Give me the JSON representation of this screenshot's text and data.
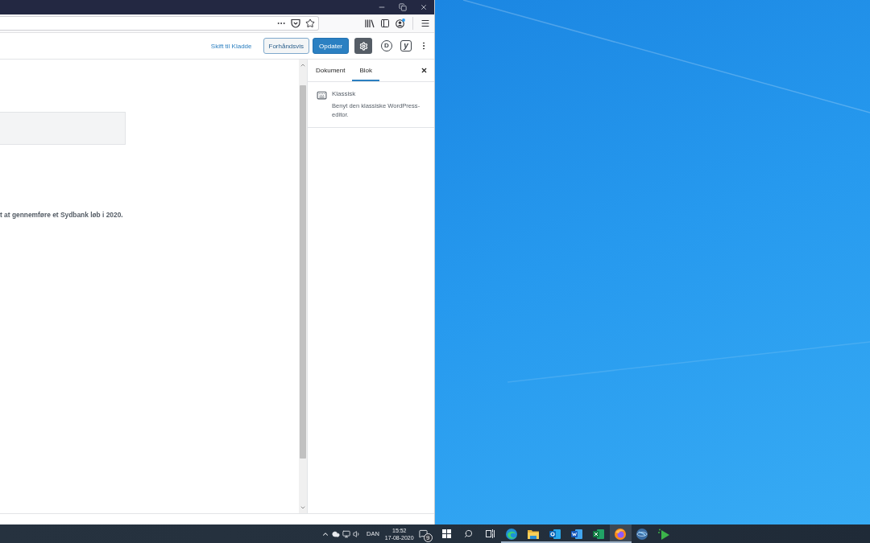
{
  "editor_header": {
    "switch_to_draft_link": "Skift til Kladde",
    "preview_button": "Forhåndsvis",
    "update_button": "Opdater",
    "settings_button": {
      "pressed": true
    },
    "plugin_buttons": [
      {
        "kind": "circle",
        "label": "D"
      },
      {
        "kind": "square",
        "label": "y"
      }
    ]
  },
  "editor_canvas": {
    "paragraph": "t at gennemføre et Sydbank løb i 2020."
  },
  "sidebar": {
    "tabs": [
      {
        "label": "Dokument",
        "selected": false
      },
      {
        "label": "Blok",
        "selected": true
      }
    ],
    "block": {
      "name": "Klassisk",
      "description": "Benyt den klassiske WordPress-editor."
    }
  },
  "taskbar": {
    "tray": {
      "language": "DAN",
      "time": "15:52",
      "date": "17-08-2020",
      "notification_count": "9"
    },
    "apps": [
      {
        "kind": "edge",
        "running": true,
        "selected": false
      },
      {
        "kind": "explorer",
        "running": true,
        "selected": false
      },
      {
        "kind": "outlook",
        "running": true,
        "selected": false
      },
      {
        "kind": "word",
        "running": true,
        "selected": false
      },
      {
        "kind": "excel",
        "running": true,
        "selected": false
      },
      {
        "kind": "firefox",
        "running": true,
        "selected": true
      },
      {
        "kind": "globe",
        "running": false,
        "selected": false
      },
      {
        "kind": "arrow",
        "running": false,
        "selected": false
      }
    ]
  }
}
